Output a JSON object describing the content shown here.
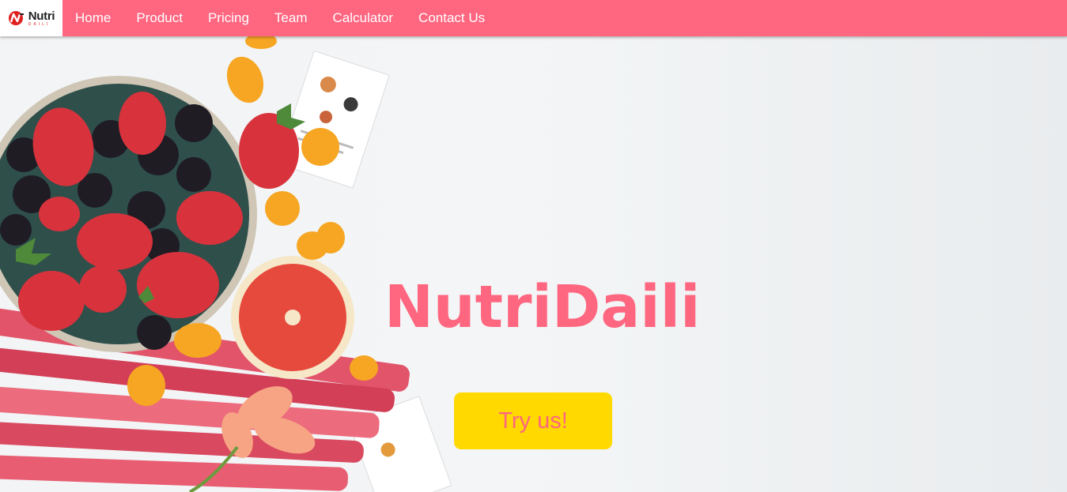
{
  "brand": {
    "name": "Nutri",
    "sub": "DAILI"
  },
  "nav": {
    "items": [
      {
        "label": "Home"
      },
      {
        "label": "Product"
      },
      {
        "label": "Pricing"
      },
      {
        "label": "Team"
      },
      {
        "label": "Calculator"
      },
      {
        "label": "Contact Us"
      }
    ]
  },
  "hero": {
    "title": "NutriDaili",
    "cta_label": "Try us!",
    "image": "fruit-bowl-photo"
  },
  "colors": {
    "accent": "#ff6680",
    "cta": "#ffd900",
    "nav_text": "#ffffff"
  }
}
